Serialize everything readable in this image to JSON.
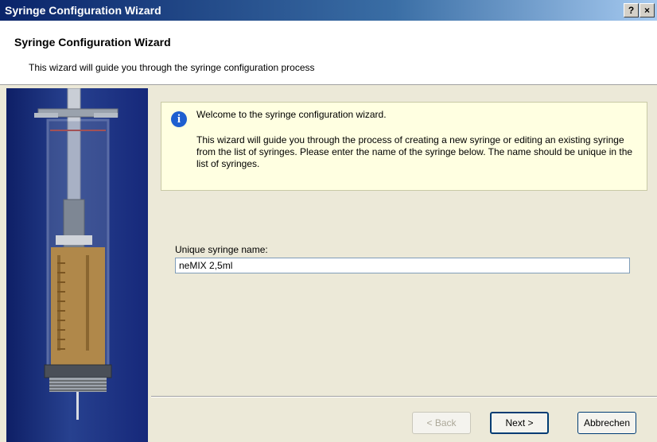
{
  "window": {
    "title": "Syringe Configuration Wizard",
    "help_label": "?",
    "close_label": "×"
  },
  "header": {
    "title": "Syringe Configuration Wizard",
    "subtitle": "This wizard will guide you through the syringe configuration process"
  },
  "info": {
    "icon": "info-icon",
    "title": "Welcome to the syringe configuration wizard.",
    "body": "This wizard will guide you through the process of creating a new syringe or editing an existing syringe from the list of syringes. Please enter the name of the syringe below. The name should be unique in the list of syringes."
  },
  "form": {
    "name_label": "Unique syringe name:",
    "name_value": "neMIX 2,5ml"
  },
  "buttons": {
    "back": "< Back",
    "next": "Next >",
    "cancel": "Abbrechen"
  },
  "colors": {
    "title_bar": "#0a246a",
    "info_bg": "#ffffe1",
    "side_panel": "#1b2f7a"
  }
}
